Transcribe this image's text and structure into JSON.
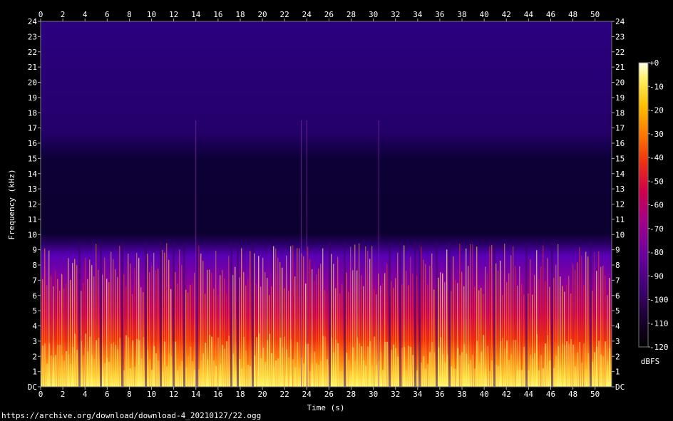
{
  "chart_data": {
    "type": "heatmap",
    "title": "",
    "xlabel": "Time (s)",
    "ylabel": "Frequency (kHz)",
    "xlim": [
      0,
      51.5
    ],
    "ylim": [
      0,
      24
    ],
    "x_ticks": [
      "0",
      "2",
      "4",
      "6",
      "8",
      "10",
      "12",
      "14",
      "16",
      "18",
      "20",
      "22",
      "24",
      "26",
      "28",
      "30",
      "32",
      "34",
      "36",
      "38",
      "40",
      "42",
      "44",
      "46",
      "48",
      "50"
    ],
    "y_ticks": [
      "DC",
      "1",
      "2",
      "3",
      "4",
      "5",
      "6",
      "7",
      "8",
      "9",
      "10",
      "11",
      "12",
      "13",
      "14",
      "15",
      "16",
      "17",
      "18",
      "19",
      "20",
      "21",
      "22",
      "23",
      "24"
    ],
    "colorbar": {
      "label": "dBFS",
      "ticks": [
        "+0",
        "-10",
        "-20",
        "-30",
        "-40",
        "-50",
        "-60",
        "-70",
        "-80",
        "-90",
        "-100",
        "-110",
        "-120"
      ],
      "range": [
        -120,
        0
      ],
      "colors": [
        "#000000",
        "#1a0030",
        "#3c0070",
        "#6a00a0",
        "#a0008a",
        "#d0004a",
        "#f03010",
        "#ff7a00",
        "#ffc000",
        "#ffee60",
        "#ffffe8"
      ]
    },
    "energy_profile": [
      {
        "khz_from": 0,
        "khz_to": 2,
        "dbfs": -20
      },
      {
        "khz_from": 2,
        "khz_to": 4,
        "dbfs": -35
      },
      {
        "khz_from": 4,
        "khz_to": 9,
        "dbfs": -55
      },
      {
        "khz_from": 9,
        "khz_to": 10,
        "dbfs": -90
      },
      {
        "khz_from": 10,
        "khz_to": 17,
        "dbfs": -112
      },
      {
        "khz_from": 17,
        "khz_to": 24,
        "dbfs": -100
      }
    ],
    "transients_s": [
      14.0,
      23.5,
      24.0,
      30.5
    ]
  },
  "footer": {
    "source": "https://archive.org/download/download-4_20210127/22.ogg"
  }
}
